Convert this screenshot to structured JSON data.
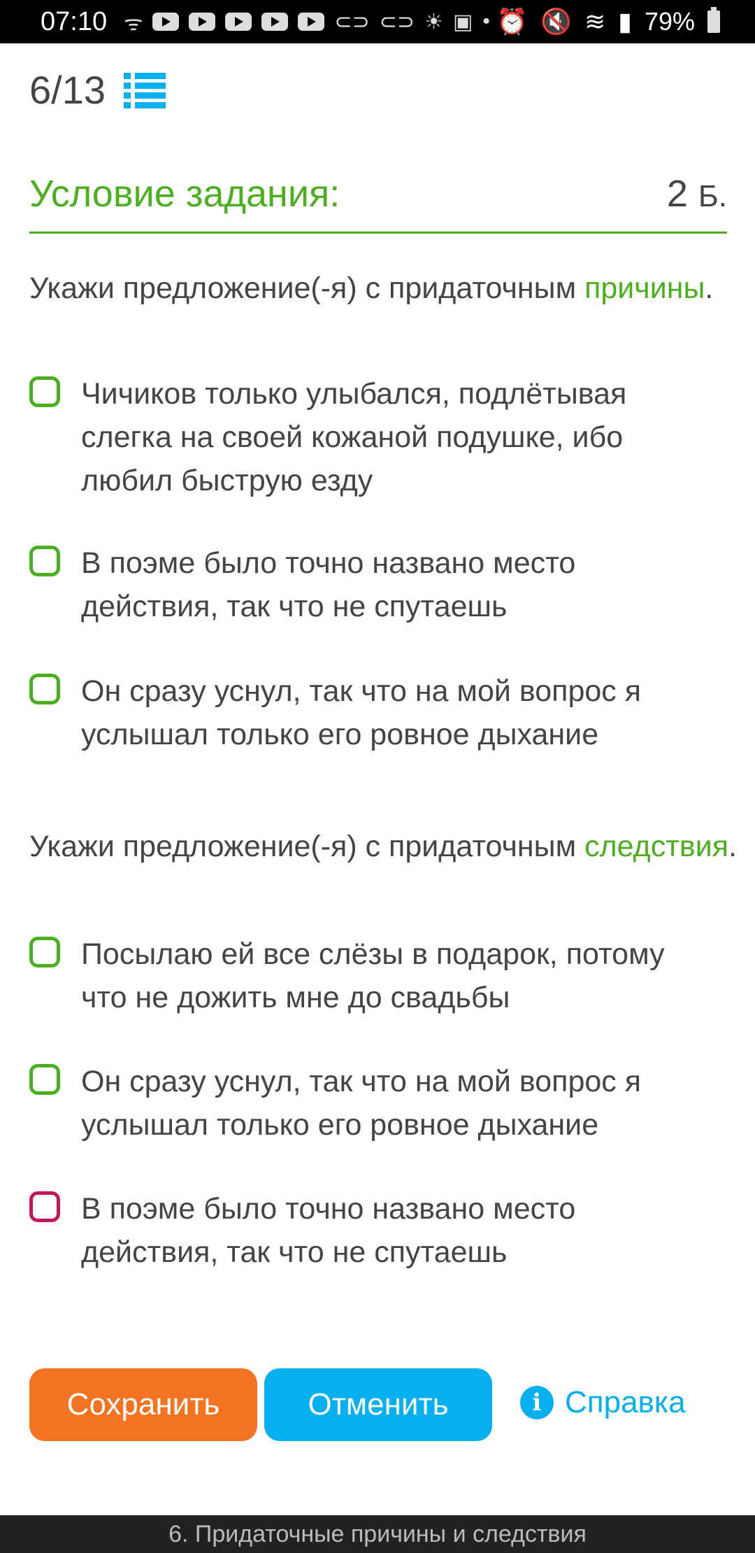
{
  "status_bar": {
    "time": "07:10",
    "battery": "79%",
    "icons": [
      "rss-icon",
      "youtube-icon",
      "youtube-icon",
      "youtube-icon",
      "youtube-icon",
      "youtube-icon",
      "link-icon",
      "link-icon",
      "weather-icon",
      "twitch-icon",
      "dot-icon",
      "alarm-icon",
      "mute-icon",
      "wifi-icon",
      "signal-icon",
      "battery-icon"
    ]
  },
  "header": {
    "progress": "6/13"
  },
  "task": {
    "title": "Условие задания:",
    "points_value": "2",
    "points_unit": "Б."
  },
  "questions": [
    {
      "prefix": "Укажи предложение(-я) с придаточным ",
      "highlight": "причины",
      "suffix": ".",
      "options": [
        {
          "text": "Чичиков только улыбался, подлётывая слегка на своей кожаной подушке, ибо любил быструю езду",
          "checked": false
        },
        {
          "text": "В поэме было точно названо место действия, так что не спутаешь",
          "checked": false
        },
        {
          "text": "Он сразу уснул, так что на мой вопрос я услышал только его ровное дыхание",
          "checked": false
        }
      ]
    },
    {
      "prefix": "Укажи предложение(-я) с придаточным ",
      "highlight": "следствия",
      "suffix": ".",
      "options": [
        {
          "text": "Посылаю ей все слёзы в подарок, потому что не дожить мне до свадьбы",
          "checked": false
        },
        {
          "text": "Он сразу уснул, так что на мой вопрос я услышал только его ровное дыхание",
          "checked": false
        },
        {
          "text": "В поэме было точно названо место действия, так что не спутаешь",
          "checked": false
        }
      ]
    }
  ],
  "actions": {
    "save": "Сохранить",
    "cancel": "Отменить",
    "help": "Справка"
  },
  "footer": {
    "text": "6. Придаточные причины и следствия"
  },
  "colors": {
    "accent_green": "#4caf1f",
    "save_orange": "#f47321",
    "cancel_blue": "#05aff0",
    "pink_checkbox": "#c2185b"
  }
}
